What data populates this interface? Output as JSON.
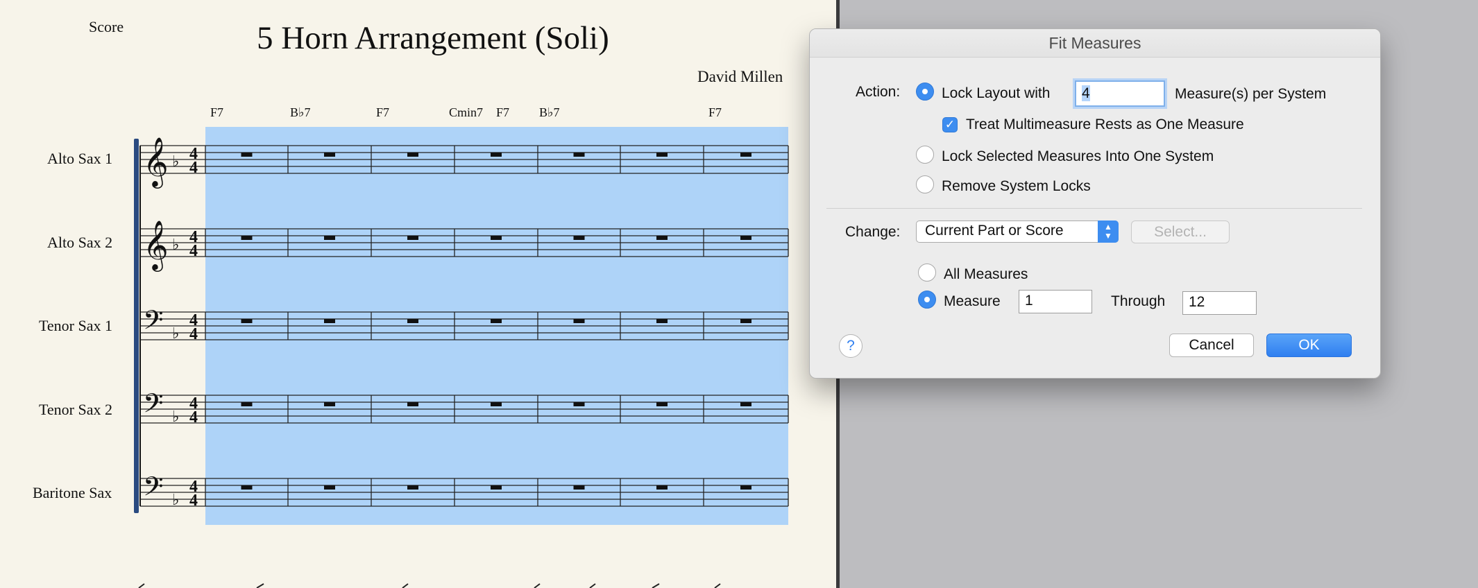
{
  "score": {
    "label": "Score",
    "title": "5 Horn Arrangement (Soli)",
    "composer": "David Millen",
    "chords": [
      "F7",
      "B♭7",
      "F7",
      "Cmin7",
      "F7",
      "B♭7",
      "F7"
    ],
    "instruments": [
      "Alto Sax 1",
      "Alto Sax 2",
      "Tenor Sax 1",
      "Tenor Sax 2",
      "Baritone Sax"
    ],
    "key_signature": "F major (1 flat)",
    "time_signature": "4/4",
    "measures_visible": 7,
    "selection_color": "#aed3f8"
  },
  "dialog": {
    "title": "Fit Measures",
    "action_label": "Action:",
    "lock_layout_label": "Lock Layout with",
    "measures_per_system_value": "4",
    "measures_per_system_suffix": "Measure(s) per System",
    "treat_multimeasure_label": "Treat Multimeasure Rests as One Measure",
    "treat_multimeasure_checked": true,
    "lock_selected_label": "Lock Selected Measures Into One System",
    "remove_locks_label": "Remove System Locks",
    "selected_action": "lock_layout",
    "change_label": "Change:",
    "change_value": "Current Part or Score",
    "select_button": "Select...",
    "all_measures_label": "All Measures",
    "measure_label": "Measure",
    "measure_from": "1",
    "through_label": "Through",
    "measure_to": "12",
    "selected_range": "measure",
    "help_label": "?",
    "cancel_label": "Cancel",
    "ok_label": "OK",
    "accent_color": "#3d8df0"
  }
}
